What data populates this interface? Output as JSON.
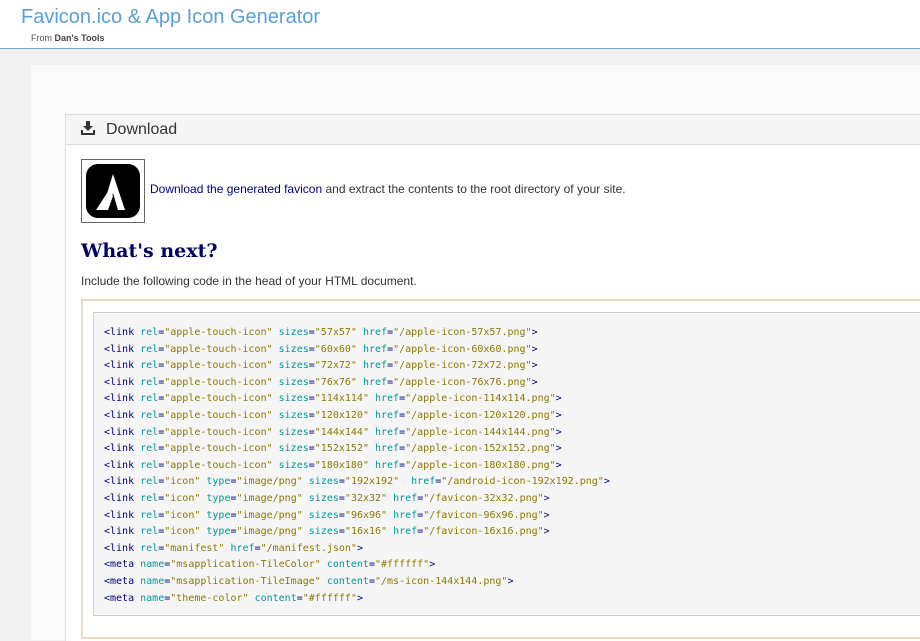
{
  "header": {
    "title": "Favicon.ico & App Icon Generator",
    "subtitle_prefix": "From",
    "subtitle_brand": "Dan's Tools"
  },
  "panel": {
    "title": "Download",
    "icon": "download-icon",
    "download_link": "Download the generated favicon",
    "download_rest": "and extract the contents to the root directory of your site.",
    "whats_next": "What's next?",
    "include_text": "Include the following code in the head of your HTML document."
  },
  "code_lines": [
    {
      "tag": "link",
      "attrs": [
        [
          "rel",
          "apple-touch-icon"
        ],
        [
          "sizes",
          "57x57"
        ],
        [
          "href",
          "/apple-icon-57x57.png"
        ]
      ]
    },
    {
      "tag": "link",
      "attrs": [
        [
          "rel",
          "apple-touch-icon"
        ],
        [
          "sizes",
          "60x60"
        ],
        [
          "href",
          "/apple-icon-60x60.png"
        ]
      ]
    },
    {
      "tag": "link",
      "attrs": [
        [
          "rel",
          "apple-touch-icon"
        ],
        [
          "sizes",
          "72x72"
        ],
        [
          "href",
          "/apple-icon-72x72.png"
        ]
      ]
    },
    {
      "tag": "link",
      "attrs": [
        [
          "rel",
          "apple-touch-icon"
        ],
        [
          "sizes",
          "76x76"
        ],
        [
          "href",
          "/apple-icon-76x76.png"
        ]
      ]
    },
    {
      "tag": "link",
      "attrs": [
        [
          "rel",
          "apple-touch-icon"
        ],
        [
          "sizes",
          "114x114"
        ],
        [
          "href",
          "/apple-icon-114x114.png"
        ]
      ]
    },
    {
      "tag": "link",
      "attrs": [
        [
          "rel",
          "apple-touch-icon"
        ],
        [
          "sizes",
          "120x120"
        ],
        [
          "href",
          "/apple-icon-120x120.png"
        ]
      ]
    },
    {
      "tag": "link",
      "attrs": [
        [
          "rel",
          "apple-touch-icon"
        ],
        [
          "sizes",
          "144x144"
        ],
        [
          "href",
          "/apple-icon-144x144.png"
        ]
      ]
    },
    {
      "tag": "link",
      "attrs": [
        [
          "rel",
          "apple-touch-icon"
        ],
        [
          "sizes",
          "152x152"
        ],
        [
          "href",
          "/apple-icon-152x152.png"
        ]
      ]
    },
    {
      "tag": "link",
      "attrs": [
        [
          "rel",
          "apple-touch-icon"
        ],
        [
          "sizes",
          "180x180"
        ],
        [
          "href",
          "/apple-icon-180x180.png"
        ]
      ]
    },
    {
      "tag": "link",
      "attrs": [
        [
          "rel",
          "icon"
        ],
        [
          "type",
          "image/png"
        ],
        [
          "sizes",
          "192x192"
        ],
        [
          "href",
          "/android-icon-192x192.png"
        ]
      ],
      "extra_space": true
    },
    {
      "tag": "link",
      "attrs": [
        [
          "rel",
          "icon"
        ],
        [
          "type",
          "image/png"
        ],
        [
          "sizes",
          "32x32"
        ],
        [
          "href",
          "/favicon-32x32.png"
        ]
      ]
    },
    {
      "tag": "link",
      "attrs": [
        [
          "rel",
          "icon"
        ],
        [
          "type",
          "image/png"
        ],
        [
          "sizes",
          "96x96"
        ],
        [
          "href",
          "/favicon-96x96.png"
        ]
      ]
    },
    {
      "tag": "link",
      "attrs": [
        [
          "rel",
          "icon"
        ],
        [
          "type",
          "image/png"
        ],
        [
          "sizes",
          "16x16"
        ],
        [
          "href",
          "/favicon-16x16.png"
        ]
      ]
    },
    {
      "tag": "link",
      "attrs": [
        [
          "rel",
          "manifest"
        ],
        [
          "href",
          "/manifest.json"
        ]
      ]
    },
    {
      "tag": "meta",
      "attrs": [
        [
          "name",
          "msapplication-TileColor"
        ],
        [
          "content",
          "#ffffff"
        ]
      ]
    },
    {
      "tag": "meta",
      "attrs": [
        [
          "name",
          "msapplication-TileImage"
        ],
        [
          "content",
          "/ms-icon-144x144.png"
        ]
      ]
    },
    {
      "tag": "meta",
      "attrs": [
        [
          "name",
          "theme-color"
        ],
        [
          "content",
          "#ffffff"
        ]
      ]
    }
  ],
  "colors": {
    "header_title": "#5b9fd6",
    "heading": "#000066",
    "link": "#000080",
    "code_tag": "#000080",
    "code_attr": "#009999",
    "code_value": "#8a7a00"
  }
}
